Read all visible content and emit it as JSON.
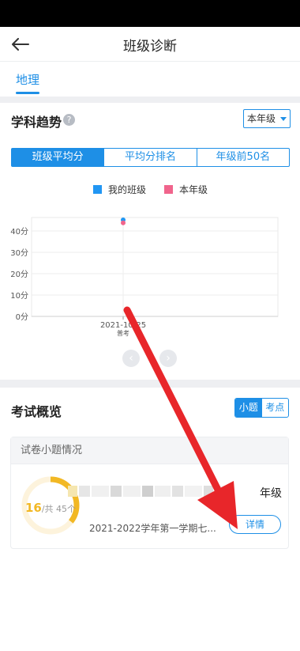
{
  "header": {
    "title": "班级诊断"
  },
  "subject_tabs": [
    "地理"
  ],
  "trend": {
    "title": "学科趋势",
    "help_glyph": "?",
    "grade_select": "本年级",
    "segments": [
      "班级平均分",
      "平均分排名",
      "年级前50名"
    ],
    "legend": [
      {
        "label": "我的班级",
        "color": "#2196f3"
      },
      {
        "label": "本年级",
        "color": "#f0648c"
      }
    ]
  },
  "chart_data": {
    "type": "scatter",
    "title": "",
    "xlabel": "",
    "ylabel": "",
    "x_categories": [
      [
        "2021-10-25",
        "普考"
      ]
    ],
    "y_ticks": [
      "0分",
      "10分",
      "20分",
      "30分",
      "40分"
    ],
    "ylim": [
      0,
      40
    ],
    "grid": true,
    "series": [
      {
        "name": "我的班级",
        "color": "#2196f3",
        "values": [
          45.2
        ]
      },
      {
        "name": "本年级",
        "color": "#f0648c",
        "values": [
          43.8
        ]
      }
    ]
  },
  "pager": {
    "prev": "‹",
    "next": "›"
  },
  "overview": {
    "title": "考试概览",
    "toggle": [
      "小题",
      "考点"
    ],
    "card_header": "试卷小题情况",
    "ring": {
      "score": "16",
      "total_text": "/共 45个",
      "fraction": 0.356
    },
    "exam_name_suffix": "年级",
    "exam_subtitle": "2021-2022学年第一学期七...",
    "detail_button": "详情"
  },
  "colors": {
    "accent": "#1e8fe6",
    "ring": "#f2b824",
    "ring_track": "#fdf3dc",
    "arrow": "#e8262a"
  }
}
